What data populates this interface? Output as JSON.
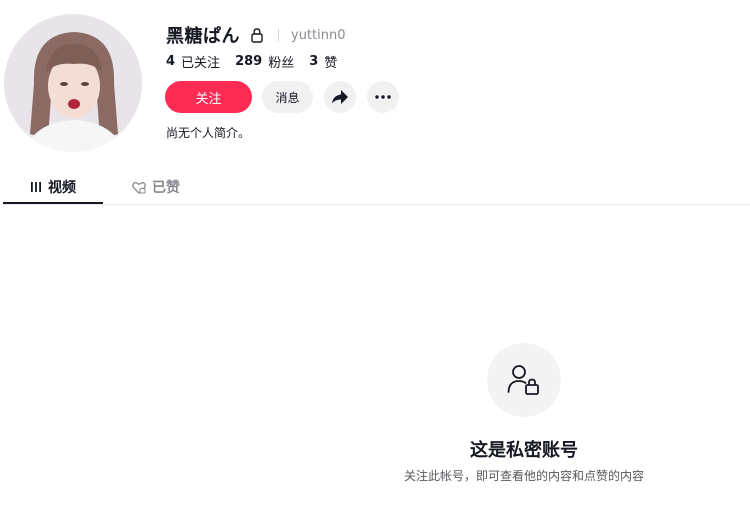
{
  "profile": {
    "display_name": "黑糖ぱん",
    "username": "yuttinn0",
    "avatar_icon": "profile-avatar-photo"
  },
  "stats": {
    "following_count": "4",
    "following_label": "已关注",
    "followers_count": "289",
    "followers_label": "粉丝",
    "likes_count": "3",
    "likes_label": "赞"
  },
  "actions": {
    "follow_label": "关注",
    "message_label": "消息",
    "share_icon": "share-icon",
    "more_icon": "more-icon"
  },
  "bio": "尚无个人简介。",
  "tabs": [
    {
      "label": "视频",
      "icon": "grid-icon",
      "active": true
    },
    {
      "label": "已赞",
      "icon": "liked-heart-icon",
      "active": false
    }
  ],
  "private_notice": {
    "icon": "user-lock-icon",
    "title": "这是私密账号",
    "description": "关注此帐号，即可查看他的内容和点赞的内容"
  },
  "colors": {
    "accent": "#fe2c55",
    "text_primary": "#161823",
    "text_secondary": "#8a8b91",
    "button_bg": "#f1f1f2"
  }
}
